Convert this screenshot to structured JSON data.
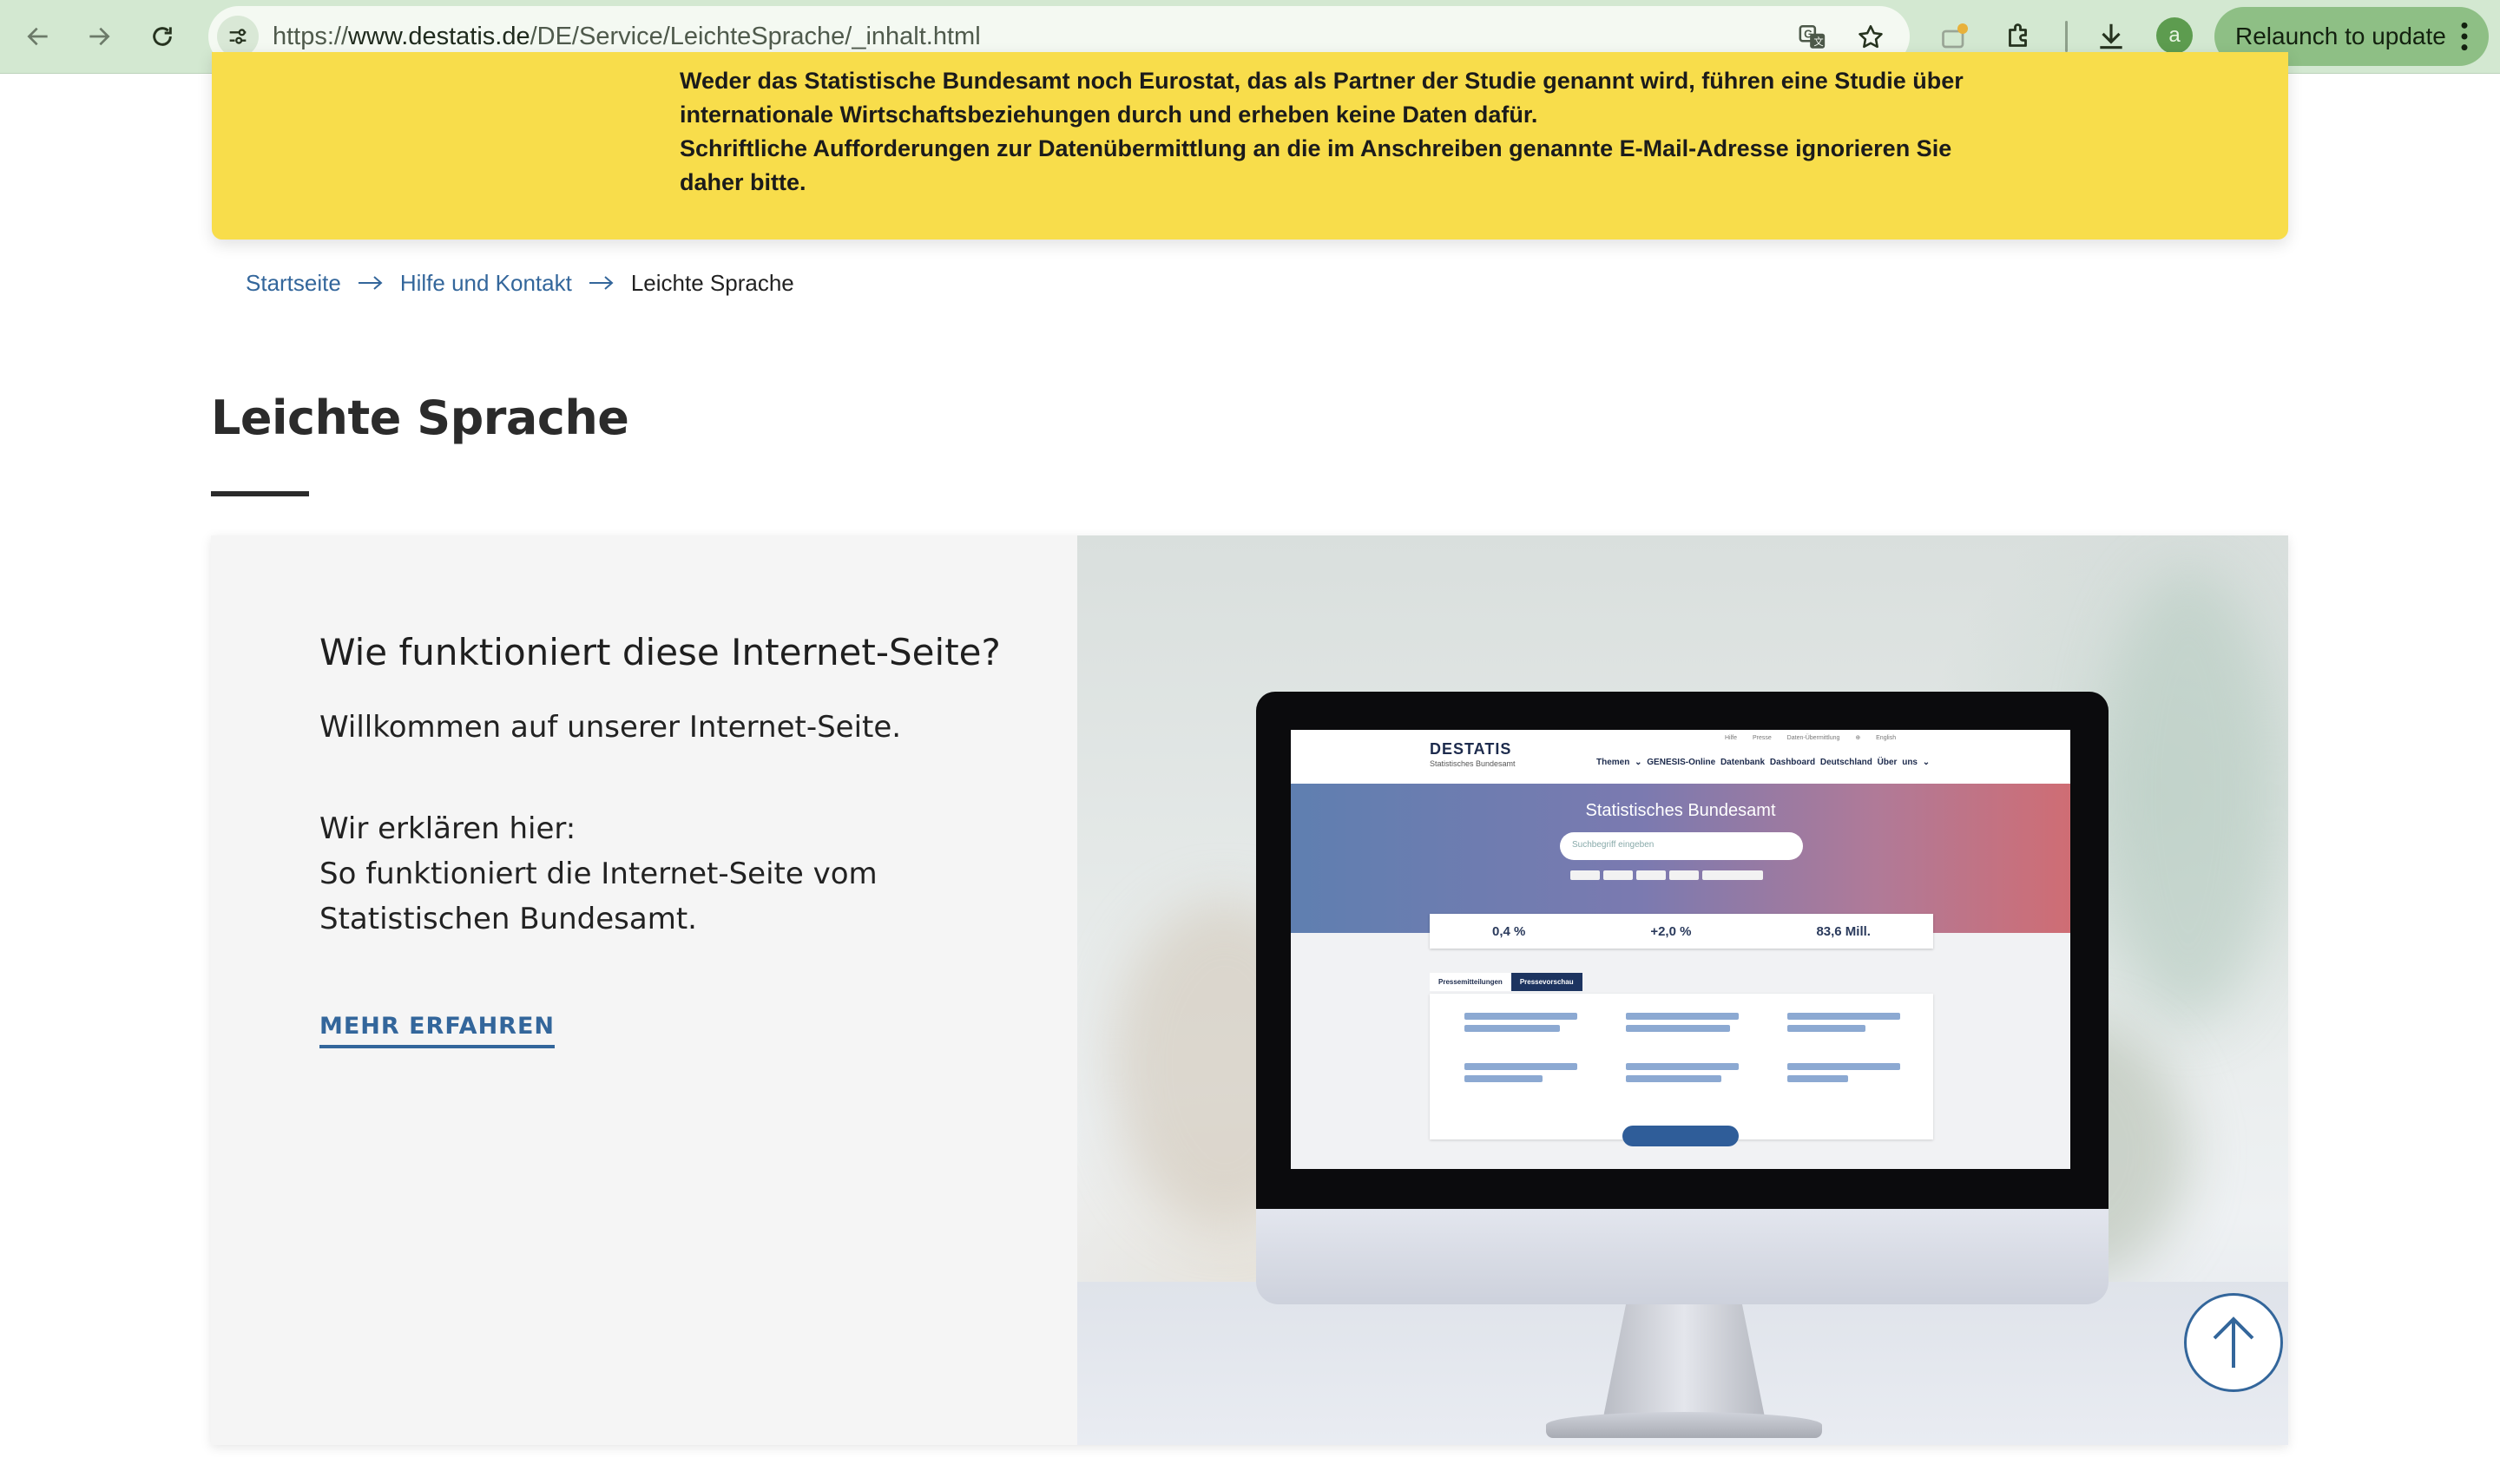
{
  "browser": {
    "url_prefix": "https://",
    "url_host": "www.destatis.de",
    "url_path": "/DE/Service/LeichteSprache/_inhalt.html",
    "relaunch_label": "Relaunch to update",
    "avatar_letter": "a",
    "icons": [
      "back-icon",
      "forward-icon",
      "reload-icon",
      "site-info-icon",
      "translate-icon",
      "bookmark-star-icon",
      "notification-icon",
      "extensions-icon",
      "download-icon",
      "menu-dots-icon"
    ]
  },
  "banner": {
    "lines": [
      "Weder das Statistische Bundesamt noch Eurostat, das als Partner der Studie genannt wird, führen eine Studie über",
      "internationale Wirtschaftsbeziehungen durch und erheben keine Daten dafür.",
      "Schriftliche Aufforderungen zur Datenübermittlung an die im Anschreiben genannte E-Mail-Adresse ignorieren Sie",
      "daher bitte."
    ],
    "background": "#f8dd4b"
  },
  "breadcrumb": {
    "items": [
      "Startseite",
      "Hilfe und Kontakt"
    ],
    "current": "Leichte Sprache"
  },
  "page": {
    "title": "Leichte Sprache"
  },
  "card": {
    "heading": "Wie funktioniert diese Internet-Seite?",
    "welcome": "Willkommen auf unserer Internet-Seite.",
    "explain_lines": [
      "Wir erklären hier:",
      "So funktioniert die Internet-Seite vom",
      "Statistischen Bundesamt."
    ],
    "more_link": "MEHR ERFAHREN",
    "accent": "#33669b"
  },
  "illustration": {
    "logo": "DESTATIS",
    "logo_sub": "Statistisches Bundesamt",
    "toplinks": "Hilfe Presse Daten-Übermittlung ⊕ English",
    "nav": "Themen ⌄  GENESIS-Online Datenbank  Dashboard Deutschland  Über uns ⌄",
    "hero_title": "Statistisches Bundesamt",
    "search_placeholder": "Suchbegriff eingeben",
    "stats": [
      "0,4 %",
      "+2,0 %",
      "83,6 Mill."
    ],
    "tabs": [
      "Pressemitteilungen",
      "Pressevorschau"
    ]
  },
  "scroll_top": {
    "icon": "arrow-up-icon"
  }
}
